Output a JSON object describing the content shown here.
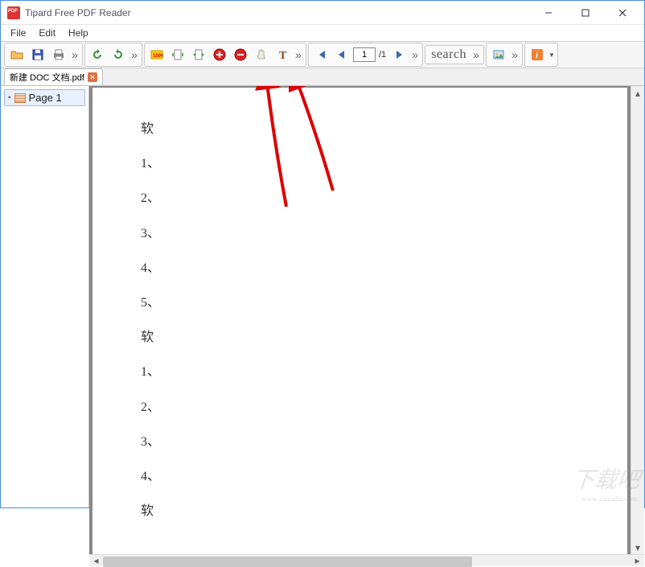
{
  "window": {
    "title": "Tipard Free PDF Reader"
  },
  "menu": {
    "file": "File",
    "edit": "Edit",
    "help": "Help"
  },
  "toolbar": {
    "page_current": "1",
    "page_total": "/1",
    "search_placeholder": "search"
  },
  "tab": {
    "filename": "新建 DOC 文档.pdf"
  },
  "sidebar": {
    "page1": "Page 1"
  },
  "document": {
    "lines": [
      "软",
      "1、",
      "2、",
      "3、",
      "4、",
      "5、",
      "软",
      "1、",
      "2、",
      "3、",
      "4、",
      "软"
    ]
  },
  "watermark": {
    "text": "下载吧",
    "url": "www.xiazaiba.com"
  }
}
